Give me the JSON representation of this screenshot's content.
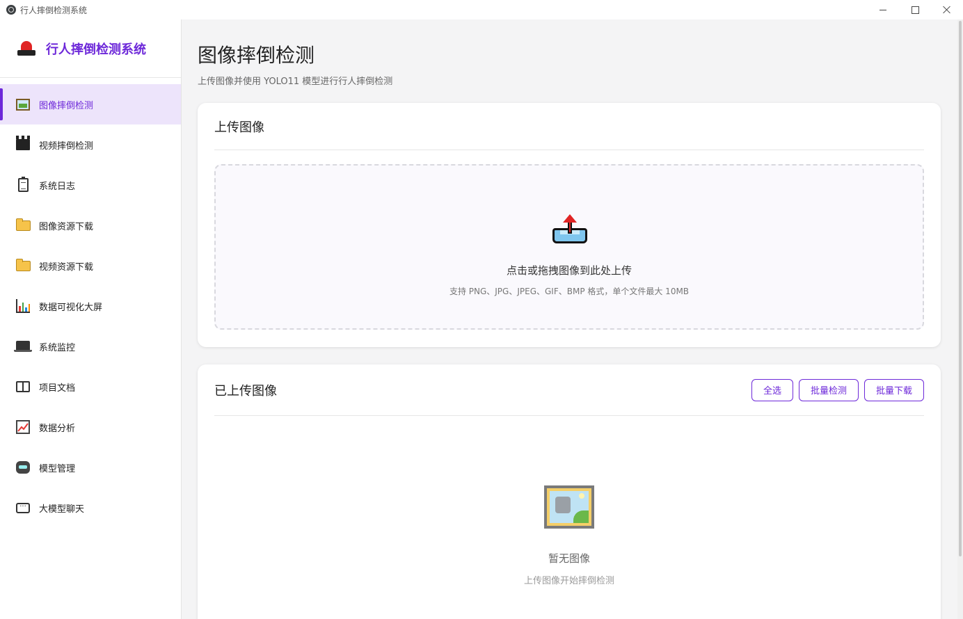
{
  "window": {
    "title": "行人摔倒检测系统"
  },
  "sidebar": {
    "brand": "行人摔倒检测系统",
    "items": [
      {
        "label": "图像摔倒检测",
        "icon": "framed-picture-icon",
        "active": true
      },
      {
        "label": "视频摔倒检测",
        "icon": "clapper-board-icon"
      },
      {
        "label": "系统日志",
        "icon": "clipboard-icon"
      },
      {
        "label": "图像资源下载",
        "icon": "folder-icon"
      },
      {
        "label": "视频资源下载",
        "icon": "folder-icon"
      },
      {
        "label": "数据可视化大屏",
        "icon": "bar-chart-icon"
      },
      {
        "label": "系统监控",
        "icon": "laptop-icon"
      },
      {
        "label": "项目文档",
        "icon": "book-icon"
      },
      {
        "label": "数据分析",
        "icon": "line-chart-icon"
      },
      {
        "label": "模型管理",
        "icon": "robot-icon"
      },
      {
        "label": "大模型聊天",
        "icon": "speech-bubble-icon"
      }
    ]
  },
  "header": {
    "title": "图像摔倒检测",
    "subtitle": "上传图像并使用 YOLO11 模型进行行人摔倒检测"
  },
  "upload": {
    "title": "上传图像",
    "main_text": "点击或拖拽图像到此处上传",
    "hint": "支持 PNG、JPG、JPEG、GIF、BMP 格式，单个文件最大 10MB"
  },
  "uploaded": {
    "title": "已上传图像",
    "select_all": "全选",
    "batch_detect": "批量检测",
    "batch_download": "批量下载",
    "empty_title": "暂无图像",
    "empty_sub": "上传图像开始摔倒检测"
  },
  "colors": {
    "accent": "#6d28d9",
    "active_bg": "#ede4fb",
    "page_bg": "#f4f4f5"
  }
}
